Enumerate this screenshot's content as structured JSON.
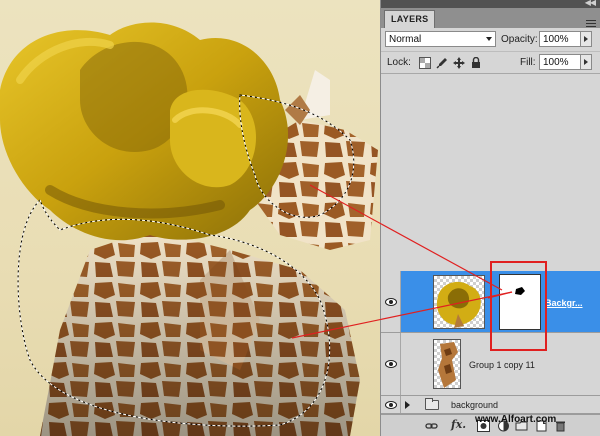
{
  "panel": {
    "tab_label": "LAYERS",
    "blend_mode": "Normal",
    "opacity_label": "Opacity:",
    "opacity_value": "100%",
    "lock_label": "Lock:",
    "fill_label": "Fill:",
    "fill_value": "100%"
  },
  "layers": [
    {
      "name": "Backgr...",
      "selected": true,
      "visible": true,
      "has_mask": true
    },
    {
      "name": "Group 1 copy 11",
      "selected": false,
      "visible": true,
      "has_mask": false
    },
    {
      "name": "background",
      "selected": false,
      "visible": true,
      "is_group": true,
      "expanded": false
    }
  ],
  "footer_icons": [
    "link-icon",
    "fx-icon",
    "add-mask-icon",
    "adjustment-icon",
    "new-group-icon",
    "new-layer-icon",
    "trash-icon"
  ],
  "watermark": "www.Alfoart.com",
  "colors": {
    "selection_highlight": "#3a8fe8",
    "annotation_red": "#e02020",
    "panel_bg": "#d6d6d6"
  }
}
